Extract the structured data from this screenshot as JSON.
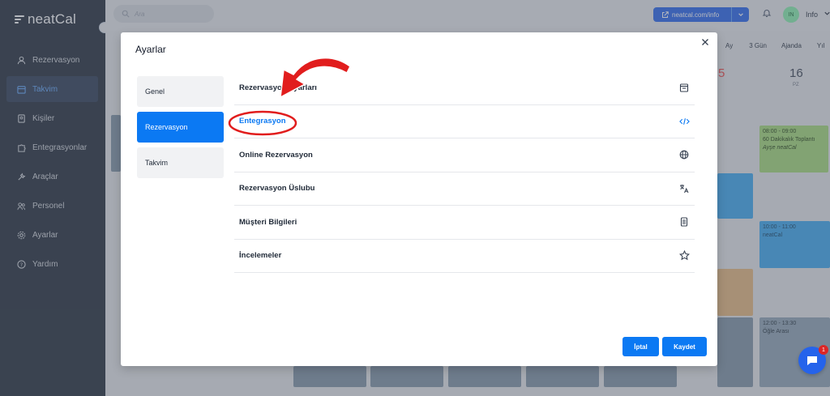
{
  "app": {
    "logo_text": "neatCal",
    "search_placeholder": "Ara",
    "link_label": "neatcal.com/info",
    "user_initials": "IN",
    "user_name": "Info"
  },
  "sidebar": {
    "items": [
      {
        "label": "Rezervasyon",
        "icon": "user-icon"
      },
      {
        "label": "Takvim",
        "icon": "calendar-icon",
        "active": true
      },
      {
        "label": "Kişiler",
        "icon": "contacts-icon"
      },
      {
        "label": "Entegrasyonlar",
        "icon": "puzzle-icon"
      },
      {
        "label": "Araçlar",
        "icon": "tools-icon"
      },
      {
        "label": "Personel",
        "icon": "people-icon"
      },
      {
        "label": "Ayarlar",
        "icon": "gear-icon"
      },
      {
        "label": "Yardım",
        "icon": "help-icon"
      }
    ]
  },
  "calendar": {
    "view_tabs": [
      "Ay",
      "3 Gün",
      "Ajanda",
      "Yıl"
    ],
    "day_partial": "5",
    "day_num": "16",
    "day_dow": "PZ",
    "events": [
      {
        "time": "08:00 - 09:00",
        "title": "60 Dakikalık Toplantı",
        "person": "Ayşe neatCal"
      },
      {
        "time": "10:00 - 11:00",
        "title": "neatCal"
      },
      {
        "time": "12:00 - 13:30",
        "title": "Öğle Arası"
      }
    ],
    "chat_badge": "1"
  },
  "modal": {
    "title": "Ayarlar",
    "side_tabs": [
      {
        "label": "Genel"
      },
      {
        "label": "Rezervasyon",
        "active": true
      },
      {
        "label": "Takvim"
      }
    ],
    "rows": [
      {
        "label": "Rezervasyon Ayarları",
        "icon": "calendar-box-icon"
      },
      {
        "label": "Entegrasyon",
        "icon": "code-icon",
        "active": true
      },
      {
        "label": "Online Rezervasyon",
        "icon": "globe-icon"
      },
      {
        "label": "Rezervasyon Üslubu",
        "icon": "translate-icon"
      },
      {
        "label": "Müşteri Bilgileri",
        "icon": "document-icon"
      },
      {
        "label": "İncelemeler",
        "icon": "star-icon"
      }
    ],
    "cancel_label": "İptal",
    "save_label": "Kaydet"
  },
  "colors": {
    "accent": "#0b79f3",
    "sidebar_bg": "#1f2937",
    "annotation_red": "#e11d1d"
  }
}
